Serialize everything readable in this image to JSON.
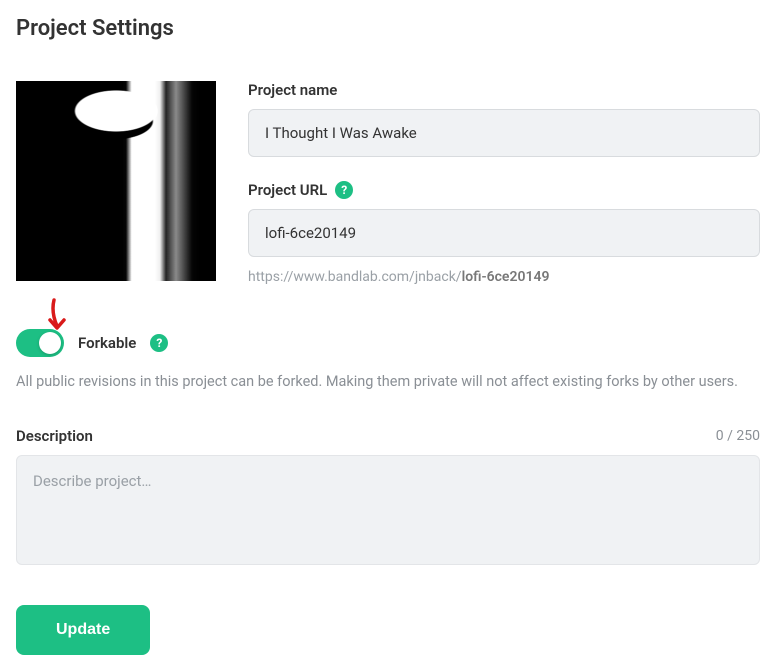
{
  "page": {
    "title": "Project Settings"
  },
  "project_name": {
    "label": "Project name",
    "value": "I Thought I Was Awake"
  },
  "project_url": {
    "label": "Project URL",
    "value": "lofi-6ce20149",
    "display_prefix": "https://www.bandlab.com/jnback/",
    "display_slug": "lofi-6ce20149"
  },
  "forkable": {
    "label": "Forkable",
    "enabled": true,
    "help_text": "All public revisions in this project can be forked. Making them private will not affect existing forks by other users."
  },
  "description": {
    "label": "Description",
    "value": "",
    "placeholder": "Describe project…",
    "char_count": "0 / 250"
  },
  "actions": {
    "update": "Update"
  }
}
